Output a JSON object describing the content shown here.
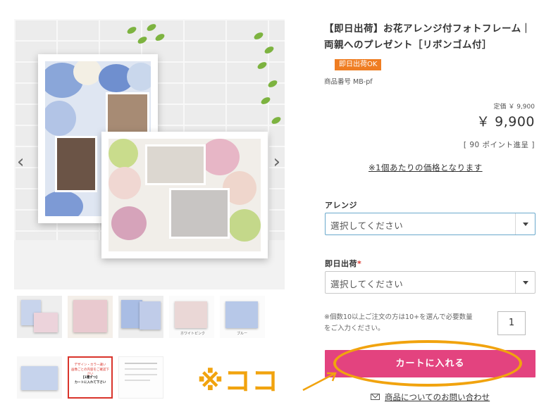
{
  "product": {
    "title_line1": "【即日出荷】お花アレンジ付フォトフレーム｜",
    "title_line2": "両親へのプレゼント［リボンゴム付］",
    "badge": "即日出荷OK",
    "sku_label": "商品番号",
    "sku": "MB-pf",
    "list_price_label": "定価",
    "list_price": "￥ 9,900",
    "price": "￥ 9,900",
    "points": "[ 90 ポイント進呈 ]",
    "per_unit_note": "※1個あたりの価格となります"
  },
  "options": {
    "arrange": {
      "label": "アレンジ",
      "selected": "選択してください"
    },
    "same_day": {
      "label": "即日出荷",
      "required_mark": "*",
      "selected": "選択してください"
    }
  },
  "quantity": {
    "note_line1": "※個数10以上ご注文の方は10+を選んで必要数量",
    "note_line2": "をご入力ください。",
    "value": "1"
  },
  "cart": {
    "button_label": "カートに入れる"
  },
  "annotation": {
    "callout": "※ココ",
    "ring_color": "#f1a30e"
  },
  "inquiry": {
    "label": "商品についてのお問い合わせ"
  },
  "thumbnails": {
    "caption_4": "ホワイトピンク",
    "caption_5": "ブルー",
    "notice_line1": "デザイン・カラー違い",
    "notice_line2": "画像ごとの内容をご確認下さい",
    "notice_line3": "【1種ずつ】",
    "notice_line4": "カートに入れて下さい"
  },
  "colors": {
    "accent_pink": "#e3437f",
    "badge_orange": "#ef7d22",
    "focus_blue": "#6aa9cc"
  }
}
